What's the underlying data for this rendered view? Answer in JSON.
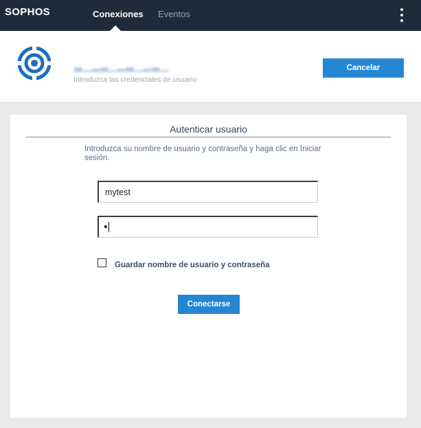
{
  "topbar": {
    "logo": "SOPHOS",
    "tabs": [
      {
        "label": "Conexiones",
        "active": true
      },
      {
        "label": "Eventos",
        "active": false
      }
    ],
    "menu_icon": "vertical-dots-icon"
  },
  "header": {
    "connection_icon": "sophos-connection-icon",
    "connection_name": "▃▁▂▃▁▂▃▁▂▃▁▂",
    "subtitle": "Introduzca las credenciales de usuario",
    "cancel_label": "Cancelar"
  },
  "auth": {
    "title": "Autenticar usuario",
    "instructions": "Introduzca su nombre de usuario y contraseña y haga clic en Iniciar sesión.",
    "username_value": "mytest",
    "password_mask": "•",
    "save_credentials_label": "Guardar nombre de usuario y contraseña",
    "save_credentials_checked": false,
    "connect_label": "Conectarse"
  },
  "colors": {
    "topbar_bg": "#1e2b3a",
    "accent": "#2586d4",
    "page_bg": "#e9e9e9"
  }
}
